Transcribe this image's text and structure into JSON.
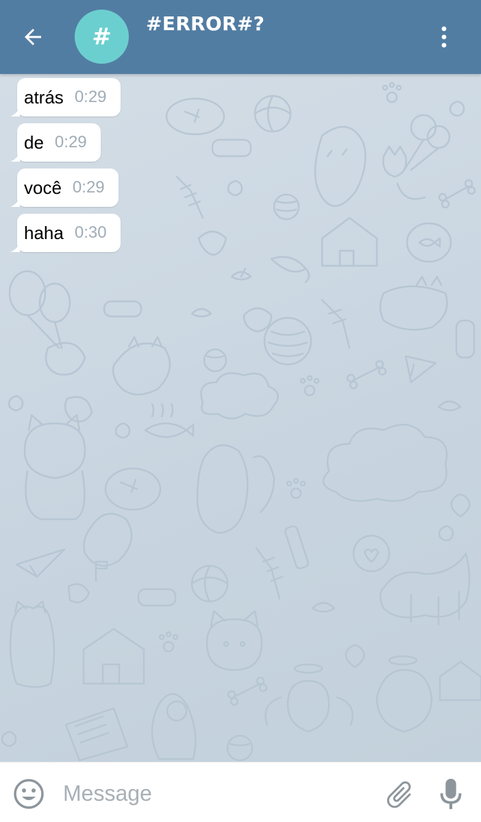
{
  "header": {
    "avatar_letter": "#",
    "title": "#ERROR#?",
    "back_icon": "arrow-left-icon",
    "menu_icon": "more-vertical-icon"
  },
  "messages": [
    {
      "text": "atrás",
      "time": "0:29"
    },
    {
      "text": "de",
      "time": "0:29"
    },
    {
      "text": "você",
      "time": "0:29"
    },
    {
      "text": "haha",
      "time": "0:30"
    }
  ],
  "composer": {
    "placeholder": "Message",
    "emoji_icon": "smiley-icon",
    "attach_icon": "paperclip-icon",
    "mic_icon": "microphone-icon"
  },
  "colors": {
    "header": "#527da3",
    "avatar": "#6ccfcf",
    "time_text": "#a0acb6"
  }
}
